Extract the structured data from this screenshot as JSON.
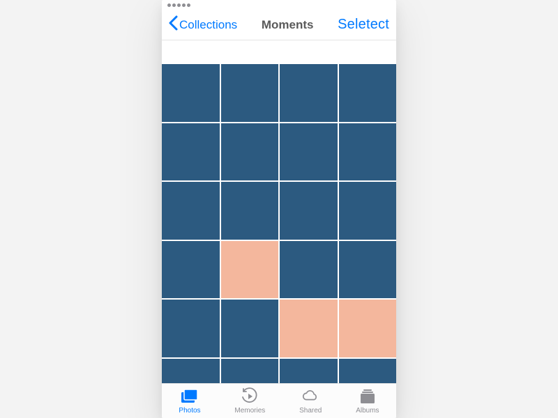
{
  "colors": {
    "accent": "#007aff",
    "inactive": "#8e8e93",
    "tile_blue": "#2c5a80",
    "tile_peach": "#f4b79d"
  },
  "nav": {
    "back_label": "Collections",
    "title": "Moments",
    "select_label": "Seletect"
  },
  "grid": {
    "columns": 4,
    "rows": [
      [
        "blue",
        "blue",
        "blue",
        "blue"
      ],
      [
        "blue",
        "blue",
        "blue",
        "blue"
      ],
      [
        "blue",
        "blue",
        "blue",
        "blue"
      ],
      [
        "blue",
        "peach",
        "blue",
        "blue"
      ],
      [
        "blue",
        "blue",
        "peach",
        "peach"
      ],
      [
        "blue",
        "blue",
        "blue",
        "blue"
      ]
    ]
  },
  "tabs": {
    "items": [
      {
        "label": "Photos",
        "icon": "photos-icon",
        "active": true
      },
      {
        "label": "Memories",
        "icon": "memories-icon",
        "active": false
      },
      {
        "label": "Shared",
        "icon": "shared-icon",
        "active": false
      },
      {
        "label": "Albums",
        "icon": "albums-icon",
        "active": false
      }
    ]
  }
}
